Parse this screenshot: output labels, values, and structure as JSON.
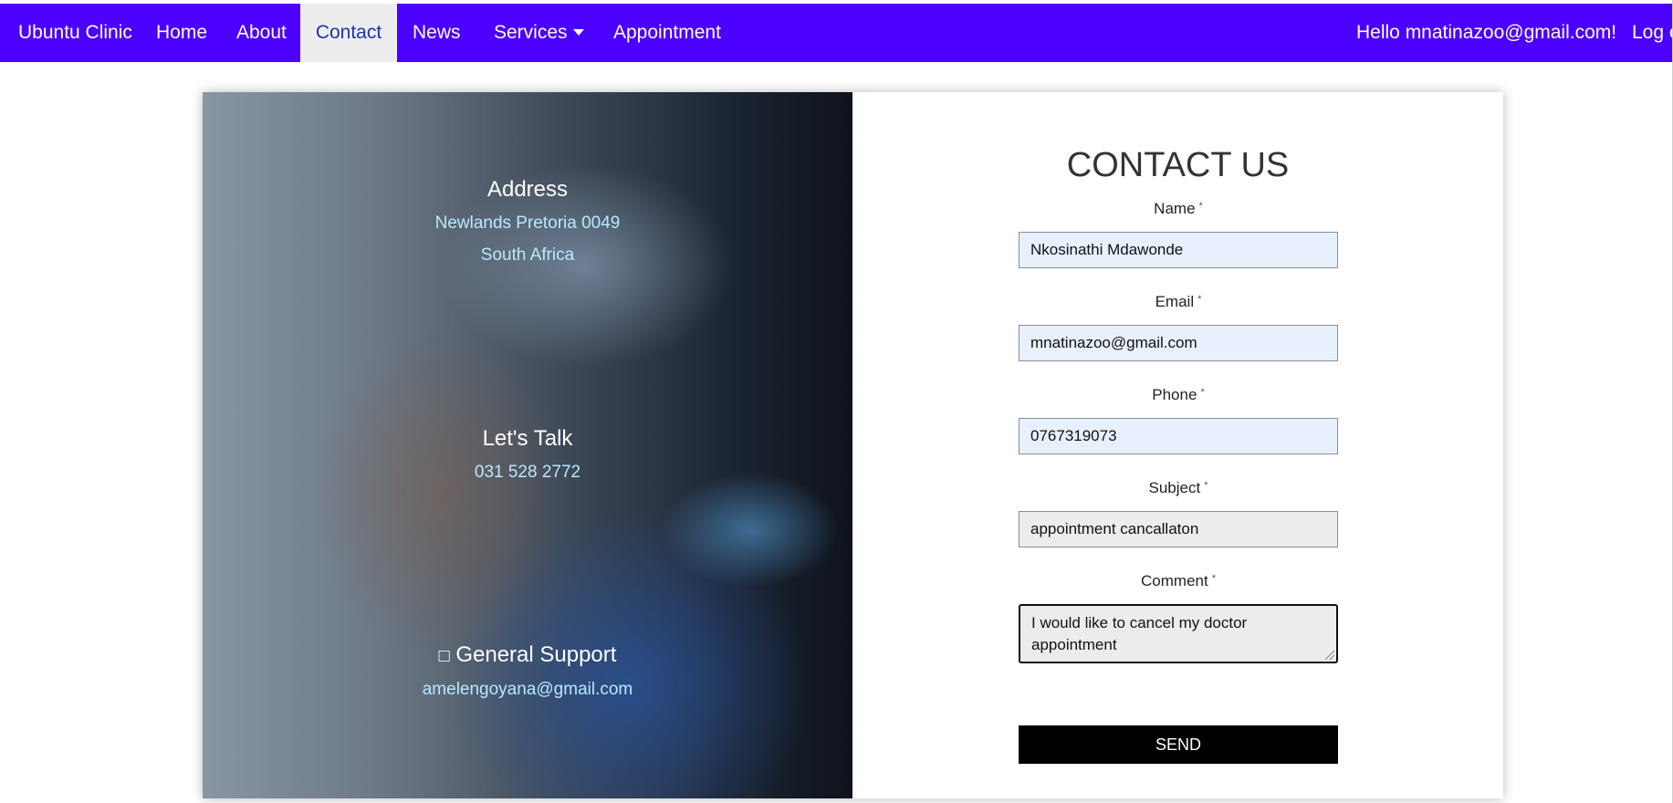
{
  "nav": {
    "brand": "Ubuntu Clinic",
    "items": [
      {
        "label": "Home"
      },
      {
        "label": "About"
      },
      {
        "label": "Contact",
        "active": true
      },
      {
        "label": "News"
      },
      {
        "label": "Services"
      },
      {
        "label": "Appointment"
      }
    ],
    "greeting": "Hello mnatinazoo@gmail.com!",
    "logout": "Log off"
  },
  "colors": {
    "navbar": "#4c00ff",
    "active_tab": "#ededed",
    "send_button": "#000000",
    "autofill_field": "#e8f0fe"
  },
  "contact_info": {
    "address_title": "Address",
    "address_line1": "Newlands Pretoria 0049",
    "address_line2": "South Africa",
    "talk_title": "Let's Talk",
    "phone": "031 528 2772",
    "support_icon": "envelope-icon",
    "support_title": "General Support",
    "support_email": "amelengoyana@gmail.com"
  },
  "form": {
    "title": "CONTACT US",
    "required_mark": "*",
    "name_label": "Name",
    "name_value": "Nkosinathi Mdawonde",
    "email_label": "Email",
    "email_value": "mnatinazoo@gmail.com",
    "phone_label": "Phone",
    "phone_value": "0767319073",
    "subject_label": "Subject",
    "subject_value": "appointment cancallaton",
    "comment_label": "Comment",
    "comment_value": "I would like to cancel my doctor appointment",
    "send_label": "SEND"
  }
}
